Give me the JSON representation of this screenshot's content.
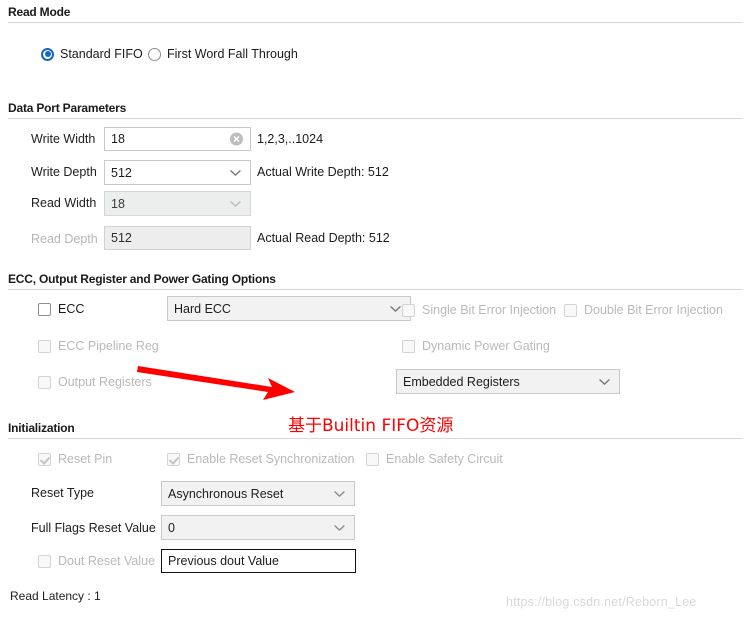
{
  "sections": {
    "read_mode": {
      "title": "Read Mode"
    },
    "data_port": {
      "title": "Data Port Parameters"
    },
    "ecc": {
      "title": "ECC, Output Register and Power Gating Options"
    },
    "init": {
      "title": "Initialization"
    }
  },
  "read_mode": {
    "options": [
      {
        "label": "Standard FIFO",
        "selected": true
      },
      {
        "label": "First Word Fall Through",
        "selected": false
      }
    ]
  },
  "data_port": {
    "write_width": {
      "label": "Write Width",
      "value": "18",
      "hint": "1,2,3,..1024",
      "clear_icon": "clear-circle-icon"
    },
    "write_depth": {
      "label": "Write Depth",
      "value": "512",
      "info": "Actual Write Depth: 512"
    },
    "read_width": {
      "label": "Read Width",
      "value": "18"
    },
    "read_depth": {
      "label": "Read Depth",
      "value": "512",
      "info": "Actual Read Depth: 512"
    }
  },
  "ecc": {
    "ecc_checkbox": {
      "label": "ECC",
      "checked": false,
      "disabled": false
    },
    "ecc_type": {
      "value": "Hard ECC"
    },
    "single_bit": {
      "label": "Single Bit Error Injection",
      "checked": false,
      "disabled": true
    },
    "double_bit": {
      "label": "Double Bit Error Injection",
      "checked": false,
      "disabled": true
    },
    "ecc_pipeline": {
      "label": "ECC Pipeline Reg",
      "checked": false,
      "disabled": true
    },
    "dynamic_power": {
      "label": "Dynamic Power Gating",
      "checked": false,
      "disabled": true
    },
    "output_registers": {
      "label": "Output Registers",
      "checked": false,
      "disabled": true
    },
    "register_type": {
      "value": "Embedded Registers"
    }
  },
  "init": {
    "reset_pin": {
      "label": "Reset Pin",
      "checked": true,
      "disabled": true
    },
    "reset_sync": {
      "label": "Enable Reset Synchronization",
      "checked": true,
      "disabled": true
    },
    "safety_circuit": {
      "label": "Enable Safety Circuit",
      "checked": false,
      "disabled": true
    },
    "reset_type": {
      "label": "Reset Type",
      "value": "Asynchronous Reset"
    },
    "full_flags": {
      "label": "Full Flags Reset Value",
      "value": "0"
    },
    "dout_reset": {
      "label": "Dout Reset Value",
      "value": "Previous dout Value",
      "checked": false,
      "disabled": true
    }
  },
  "footer": {
    "read_latency": "Read Latency : 1",
    "watermark": "https://blog.csdn.net/Reborn_Lee"
  },
  "annotation": {
    "text": "基于Builtin FIFO资源",
    "color": "#ff0000",
    "arrow_icon": "red-arrow-icon"
  },
  "colors": {
    "accent": "#1666c5",
    "annotation_red": "#ff0000",
    "rule": "#d6d6d6",
    "disabled_text": "#b6b6b6"
  }
}
